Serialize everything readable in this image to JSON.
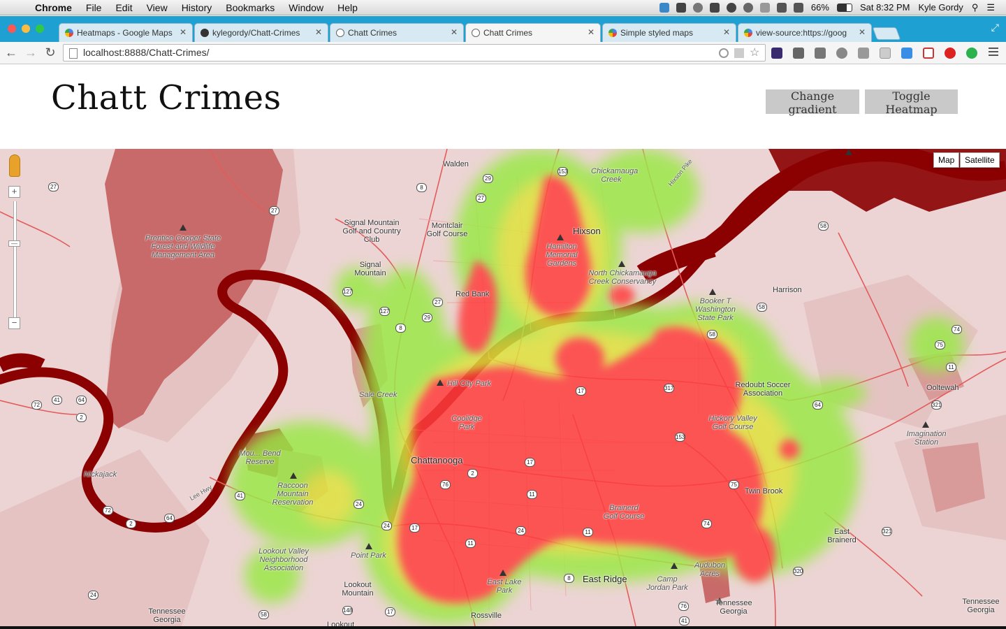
{
  "menubar": {
    "app": "Chrome",
    "menus": [
      "File",
      "Edit",
      "View",
      "History",
      "Bookmarks",
      "Window",
      "Help"
    ],
    "battery": "66%",
    "clock": "Sat 8:32 PM",
    "user": "Kyle Gordy"
  },
  "tabs": [
    {
      "title": "Heatmaps - Google Maps",
      "icon": "google-maps-icon"
    },
    {
      "title": "kylegordy/Chatt-Crimes",
      "icon": "github-icon"
    },
    {
      "title": "Chatt Crimes",
      "icon": "chrome-page-icon"
    },
    {
      "title": "Chatt Crimes",
      "icon": "chrome-page-icon"
    },
    {
      "title": "Simple styled maps",
      "icon": "google-maps-icon"
    },
    {
      "title": "view-source:https://goog",
      "icon": "google-maps-icon"
    }
  ],
  "toolbar": {
    "url": "localhost:8888/Chatt-Crimes/"
  },
  "page": {
    "title": "Chatt Crimes",
    "change_gradient": "Change gradient",
    "toggle_heatmap": "Toggle Heatmap"
  },
  "map": {
    "type_map": "Map",
    "type_satellite": "Satellite",
    "labels": {
      "walden": "Walden",
      "chickamauga": "Chickamauga Creek",
      "hixson_pike": "Hixson Pike",
      "signal_mountain_golf": "Signal Mountain Golf and Country Club",
      "montclair": "Montclair Golf Course",
      "signal_mountain": "Signal Mountain",
      "prentice": "Prentice Cooper State Forest and Wildlife Management Area",
      "hixson": "Hixson",
      "hamilton": "Hamilton Memorial Gardens",
      "north_chickamauga": "North Chickamauga Creek Conservancy",
      "red_bank": "Red Bank",
      "harrison": "Harrison",
      "booker_t": "Booker T Washington State Park",
      "hill_city": "Hill City Park",
      "redoubt": "Redoubt Soccer Association",
      "ooltewah": "Ooltewah",
      "hickory_valley": "Hickory Valley Golf Course",
      "imagination": "Imagination Station",
      "chattanooga": "Chattanooga",
      "raccoon": "Raccoon Mountain Reservation",
      "twin_brook": "Twin Brook",
      "brainerd_golf": "Brainerd Golf Course",
      "east_brainerd": "East Brainerd",
      "lookout_valley": "Lookout Valley Neighborhood Association",
      "point_park": "Point Park",
      "lookout_mountain": "Lookout Mountain",
      "east_lake": "East Lake Park",
      "east_ridge": "East Ridge",
      "camp_jordan": "Camp Jordan Park",
      "audubon": "Audubon Acres",
      "tennessee_georgia_l": "Tennessee Georgia",
      "tennessee_georgia_m": "Tennessee Georgia",
      "tennessee_georgia_r": "Tennessee Georgia",
      "coolidge": "Coolidge Park",
      "moccasin": "Mou... Bend Reserve",
      "nickajack": "Nickajack",
      "sale_creek": "Sale Creek",
      "lee_hwy": "Lee Hwy",
      "rossville": "Rossville",
      "lookout": "Lookout"
    },
    "shields": [
      "27",
      "8",
      "153",
      "29",
      "27",
      "27",
      "58",
      "127",
      "127",
      "29",
      "8",
      "27",
      "58",
      "58",
      "74",
      "11",
      "75",
      "64",
      "321",
      "17",
      "317",
      "153",
      "72",
      "41",
      "64",
      "2",
      "41",
      "72",
      "64",
      "2",
      "24",
      "24",
      "76",
      "2",
      "11",
      "11",
      "17",
      "17",
      "24",
      "11",
      "74",
      "75",
      "321",
      "320",
      "8",
      "76",
      "41",
      "58",
      "148",
      "17",
      "24"
    ],
    "colors": {
      "heat_red": "#ff3d3d",
      "heat_yellow": "#f2e23a",
      "heat_green": "#9be84a",
      "river": "#8b0000",
      "land": "#ecd4d4",
      "forest": "#c96a6a"
    }
  }
}
